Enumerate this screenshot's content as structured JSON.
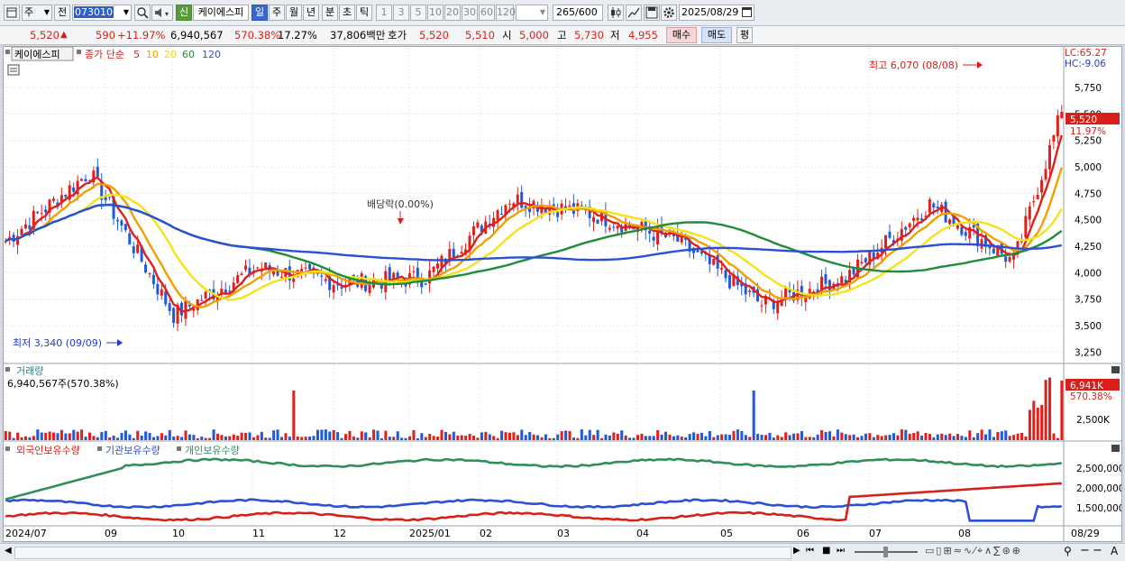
{
  "toolbar": {
    "period_short": "주",
    "prev_label": "전",
    "code_value": "073010",
    "new_badge": "신",
    "stock_name": "케이에스피",
    "period_tabs": [
      "일",
      "주",
      "월",
      "년",
      "분",
      "초",
      "틱"
    ],
    "interval_buttons": [
      "1",
      "3",
      "5",
      "10",
      "20",
      "30",
      "60",
      "120"
    ],
    "count_value": "265",
    "count_total": "/600",
    "date_value": "2025/08/29"
  },
  "quote": {
    "price": "5,520",
    "change_arrow": "▲",
    "change": "590",
    "change_pct": "+11.97%",
    "volume": "6,940,567",
    "volume_ratio": "570.38%",
    "turnover": "17.27%",
    "amount": "37,806백만",
    "bid_label": "호가",
    "ask_price": "5,520",
    "bid_price": "5,510",
    "open_label": "시",
    "open": "5,000",
    "high_label": "고",
    "high": "5,730",
    "low_label": "저",
    "low": "4,955",
    "buy_button": "매수",
    "sell_button": "매도",
    "eval_button": "평"
  },
  "price_panel": {
    "legend_stock": "케이에스피",
    "legend_ma_title": "종가 단순",
    "ma_periods": [
      "5",
      "10",
      "20",
      "60",
      "120"
    ],
    "ma_colors": [
      "#e0201b",
      "#f0a000",
      "#f3e31a",
      "#1e8c3a",
      "#2b4fd6"
    ],
    "lc_label": "LC:65.27",
    "hc_label": "HC:-9.06",
    "max_annotation": "최고 6,070 (08/08)",
    "min_annotation": "최저 3,340 (09/09)",
    "dividend_annotation": "배당락(0.00%)",
    "current_price_tag": "5,520",
    "current_pct_tag": "11.97%",
    "y_ticks": [
      "5,750",
      "5,500",
      "5,250",
      "5,000",
      "4,750",
      "4,500",
      "4,250",
      "4,000",
      "3,750",
      "3,500",
      "3,250"
    ]
  },
  "volume_panel": {
    "title": "거래량",
    "summary": "6,940,567주(570.38%)",
    "current_tag": "6,941K",
    "current_pct_tag": "570.38%",
    "y_ticks": [
      "2,500K"
    ]
  },
  "holding_panel": {
    "legend": [
      "외국인보유수량",
      "기관보유수량",
      "개인보유수량"
    ],
    "legend_colors": [
      "#d8201a",
      "#2b4fd6",
      "#2f8f5a"
    ],
    "y_ticks": [
      "2,500,000",
      "2,000,000",
      "1,500,000"
    ]
  },
  "x_axis": {
    "labels": [
      "2024/07",
      "09",
      "10",
      "11",
      "12",
      "2025/01",
      "02",
      "03",
      "04",
      "05",
      "06",
      "07",
      "08"
    ],
    "end_label": "08/29"
  },
  "chart_data": {
    "type": "candlestick",
    "symbol": "케이에스피",
    "y_range": [
      3150,
      6100
    ],
    "series": [
      {
        "name": "케이에스피",
        "points": [
          {
            "x": "2024/07",
            "y": 4300
          },
          {
            "x": "2024/08",
            "y": 4950
          },
          {
            "x": "2024/09",
            "y": 3600
          },
          {
            "x": "2024/10",
            "y": 4050
          },
          {
            "x": "2024/11",
            "y": 3900
          },
          {
            "x": "2024/12",
            "y": 3950
          },
          {
            "x": "2025/01",
            "y": 4700
          },
          {
            "x": "2025/02",
            "y": 4550
          },
          {
            "x": "2025/03",
            "y": 4300
          },
          {
            "x": "2025/04",
            "y": 3700
          },
          {
            "x": "2025/05",
            "y": 3950
          },
          {
            "x": "2025/06",
            "y": 4650
          },
          {
            "x": "2025/07",
            "y": 4100
          },
          {
            "x": "2025/08",
            "y": 5520
          }
        ]
      }
    ],
    "annotations": {
      "max": {
        "value": 6070,
        "date": "08/08"
      },
      "min": {
        "value": 3340,
        "date": "09/09"
      }
    },
    "volume_current": 6940567,
    "holding_series_max": [
      2750000,
      2300000,
      2900000
    ]
  }
}
